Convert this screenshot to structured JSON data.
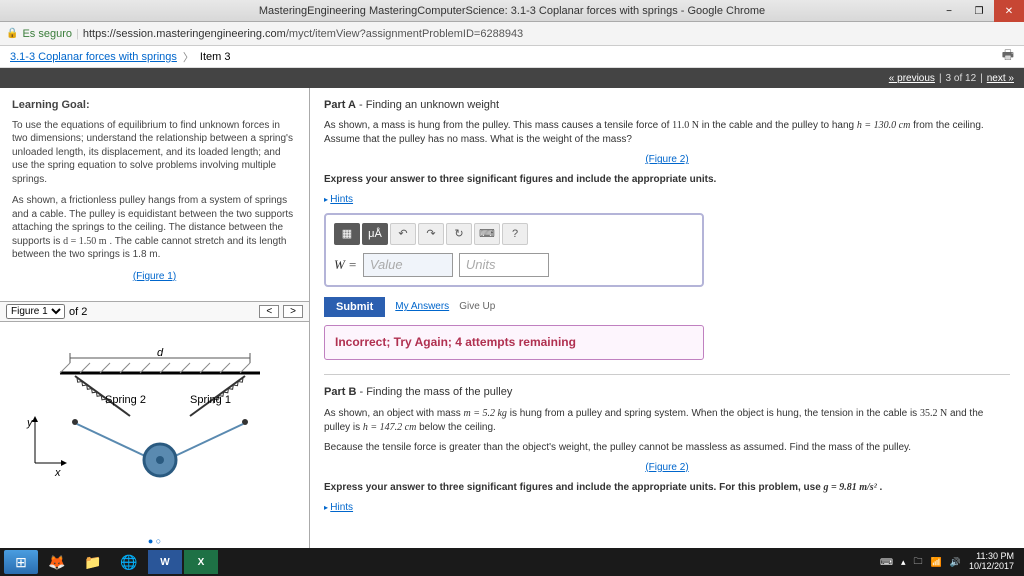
{
  "window": {
    "title": "MasteringEngineering MasteringComputerScience: 3.1-3 Coplanar forces with springs - Google Chrome",
    "minimize": "−",
    "maximize": "❐",
    "close": "✕"
  },
  "address": {
    "secure_label": "Es seguro",
    "url_host": "https://session.masteringengineering.com",
    "url_path": "/myct/itemView?assignmentProblemID=6288943"
  },
  "breadcrumb": {
    "parent": "3.1-3 Coplanar forces with springs",
    "current": "Item 3"
  },
  "pager": {
    "prev": "« previous",
    "pos": "3 of 12",
    "next": "next »"
  },
  "goal": {
    "heading": "Learning Goal:",
    "p1": "To use the equations of equilibrium to find unknown forces in two dimensions; understand the relationship between a spring's unloaded length, its displacement, and its loaded length; and use the spring equation to solve problems involving multiple springs.",
    "p2a": "As shown, a frictionless pulley hangs from a system of springs and a cable. The pulley is equidistant between the two supports attaching the springs to the ceiling. The distance between the supports is ",
    "p2_d": "d = 1.50 m",
    "p2b": " . The cable cannot stretch and its length between the two springs is 1.8 m.",
    "fig1_link": "(Figure 1)"
  },
  "figbar": {
    "select": "Figure 1",
    "of": "of 2",
    "prev": "<",
    "next": ">"
  },
  "figure": {
    "d_label": "d",
    "spring1": "Spring 1",
    "spring2": "Spring 2",
    "x": "x",
    "y": "y"
  },
  "partA": {
    "label": "Part A",
    "title": "Finding an unknown weight",
    "body1": "As shown, a mass is hung from the pulley. This mass causes a tensile force of ",
    "force": "11.0 N",
    "body2": " in the cable and the pulley to hang ",
    "h": "h = 130.0 cm",
    "body3": " from the ceiling. Assume that the pulley has no mass. What is the weight of the mass?",
    "fig2_link": "(Figure 2)",
    "instruct": "Express your answer to three significant figures and include the appropriate units.",
    "hints": "Hints",
    "var": "W =",
    "value_ph": "Value",
    "units_ph": "Units",
    "submit": "Submit",
    "myanswers": "My Answers",
    "giveup": "Give Up",
    "feedback": "Incorrect; Try Again; 4 attempts remaining"
  },
  "partB": {
    "label": "Part B",
    "title": "Finding the mass of the pulley",
    "body1": "As shown, an object with mass ",
    "m": "m = 5.2 kg",
    "body2": " is hung from a pulley and spring system. When the object is hung, the tension in the cable is ",
    "tension": "35.2 N",
    "body3": " and the pulley is ",
    "h": "h = 147.2 cm",
    "body4": " below the ceiling.",
    "body5": "Because the tensile force is greater than the object's weight, the pulley cannot be massless as assumed. Find the mass of the pulley.",
    "fig2_link": "(Figure 2)",
    "instruct_a": "Express your answer to three significant figures and include the appropriate units. For this problem, use ",
    "g": "g = 9.81 m/s²",
    "instruct_b": " .",
    "hints": "Hints"
  },
  "toolbar": {
    "frac": "▦",
    "xA": "μÅ",
    "undo": "↶",
    "redo": "↷",
    "reset": "↻",
    "kbd": "⌨",
    "help": "?"
  },
  "tray": {
    "time": "11:30 PM",
    "date": "10/12/2017"
  }
}
